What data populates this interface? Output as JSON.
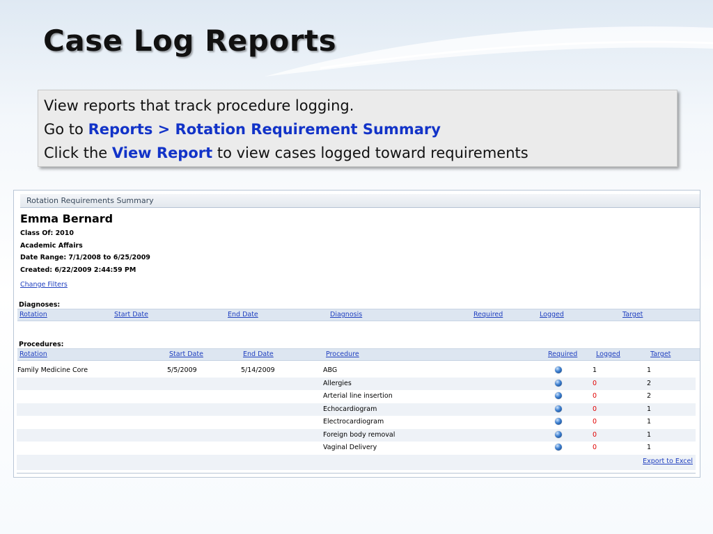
{
  "slide": {
    "title": "Case Log Reports",
    "callout": {
      "line1": "View reports that track procedure logging.",
      "line2_prefix": "Go to ",
      "line2_highlight": "Reports > Rotation Requirement Summary",
      "line3_prefix": "Click the ",
      "line3_highlight": "View Report",
      "line3_suffix": " to view cases logged toward requirements"
    }
  },
  "report": {
    "header": "Rotation Requirements Summary",
    "student_name": "Emma Bernard",
    "class_of": "Class Of: 2010",
    "department": "Academic Affairs",
    "date_range": "Date Range: 7/1/2008 to 6/25/2009",
    "created": "Created: 6/22/2009 2:44:59 PM",
    "change_filters": "Change Filters",
    "export": "Export to Excel"
  },
  "diagnoses": {
    "label": "Diagnoses:",
    "columns": {
      "rotation": "Rotation",
      "start": "Start Date",
      "end": "End Date",
      "item": "Diagnosis",
      "required": "Required",
      "logged": "Logged",
      "target": "Target"
    }
  },
  "procedures": {
    "label": "Procedures:",
    "columns": {
      "rotation": "Rotation",
      "start": "Start Date",
      "end": "End Date",
      "item": "Procedure",
      "required": "Required",
      "logged": "Logged",
      "target": "Target"
    },
    "rows": [
      {
        "rotation": "Family Medicine Core",
        "start": "5/5/2009",
        "end": "5/14/2009",
        "procedure": "ABG",
        "required": "blue-ball-icon",
        "logged": "1",
        "target": "1"
      },
      {
        "rotation": "",
        "start": "",
        "end": "",
        "procedure": "Allergies",
        "required": "blue-ball-icon",
        "logged": "0",
        "target": "2"
      },
      {
        "rotation": "",
        "start": "",
        "end": "",
        "procedure": "Arterial line insertion",
        "required": "blue-ball-icon",
        "logged": "0",
        "target": "2"
      },
      {
        "rotation": "",
        "start": "",
        "end": "",
        "procedure": "Echocardiogram",
        "required": "blue-ball-icon",
        "logged": "0",
        "target": "1"
      },
      {
        "rotation": "",
        "start": "",
        "end": "",
        "procedure": "Electrocardiogram",
        "required": "blue-ball-icon",
        "logged": "0",
        "target": "1"
      },
      {
        "rotation": "",
        "start": "",
        "end": "",
        "procedure": "Foreign body removal",
        "required": "blue-ball-icon",
        "logged": "0",
        "target": "1"
      },
      {
        "rotation": "",
        "start": "",
        "end": "",
        "procedure": "Vaginal Delivery",
        "required": "blue-ball-icon",
        "logged": "0",
        "target": "1"
      }
    ]
  },
  "colors": {
    "highlight": "#1233c8",
    "link": "#1f3fbf",
    "zero_logged": "#e00000",
    "column_bar": "#dde6f1"
  }
}
